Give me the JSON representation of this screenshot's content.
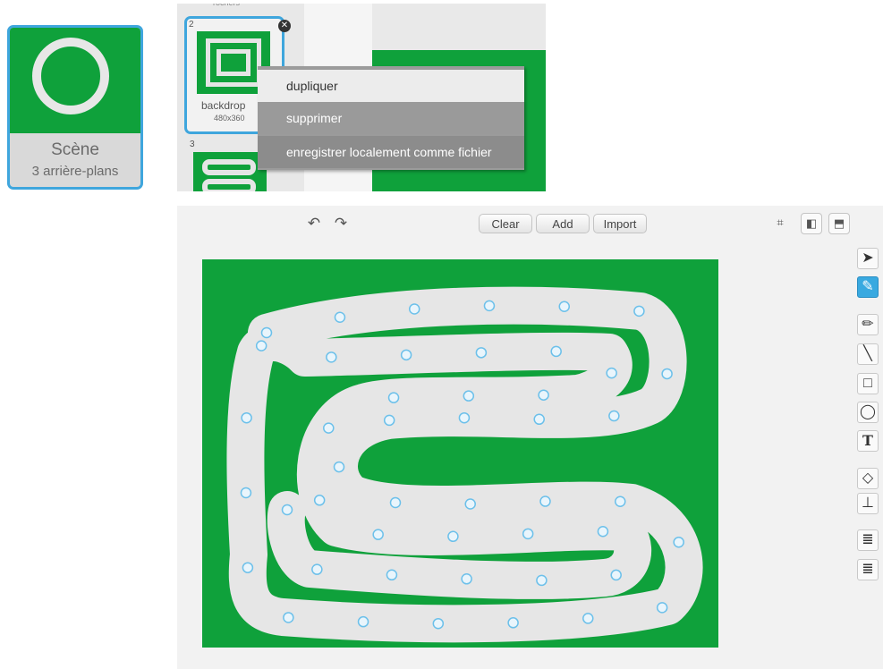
{
  "stage": {
    "title": "Scène",
    "subtitle": "3 arrière-plans"
  },
  "backdrops": {
    "top_label": "rochers",
    "items": [
      {
        "number": "2",
        "name": "backdrop",
        "size": "480x360"
      },
      {
        "number": "3"
      }
    ]
  },
  "context_menu": {
    "items": [
      "dupliquer",
      "supprimer",
      "enregistrer localement comme fichier"
    ],
    "selected": "supprimer"
  },
  "editor": {
    "clear_label": "Clear",
    "add_label": "Add",
    "import_label": "Import",
    "canvas_background": "#0fa13b",
    "track_color": "#e6e6e6",
    "tools": [
      "select-tool",
      "reshape-tool",
      "pencil-tool",
      "line-tool",
      "rectangle-tool",
      "ellipse-tool",
      "text-tool",
      "fill-tool",
      "stamp-tool",
      "forward-layer-tool",
      "back-layer-tool"
    ],
    "active_tool": "reshape-tool"
  }
}
